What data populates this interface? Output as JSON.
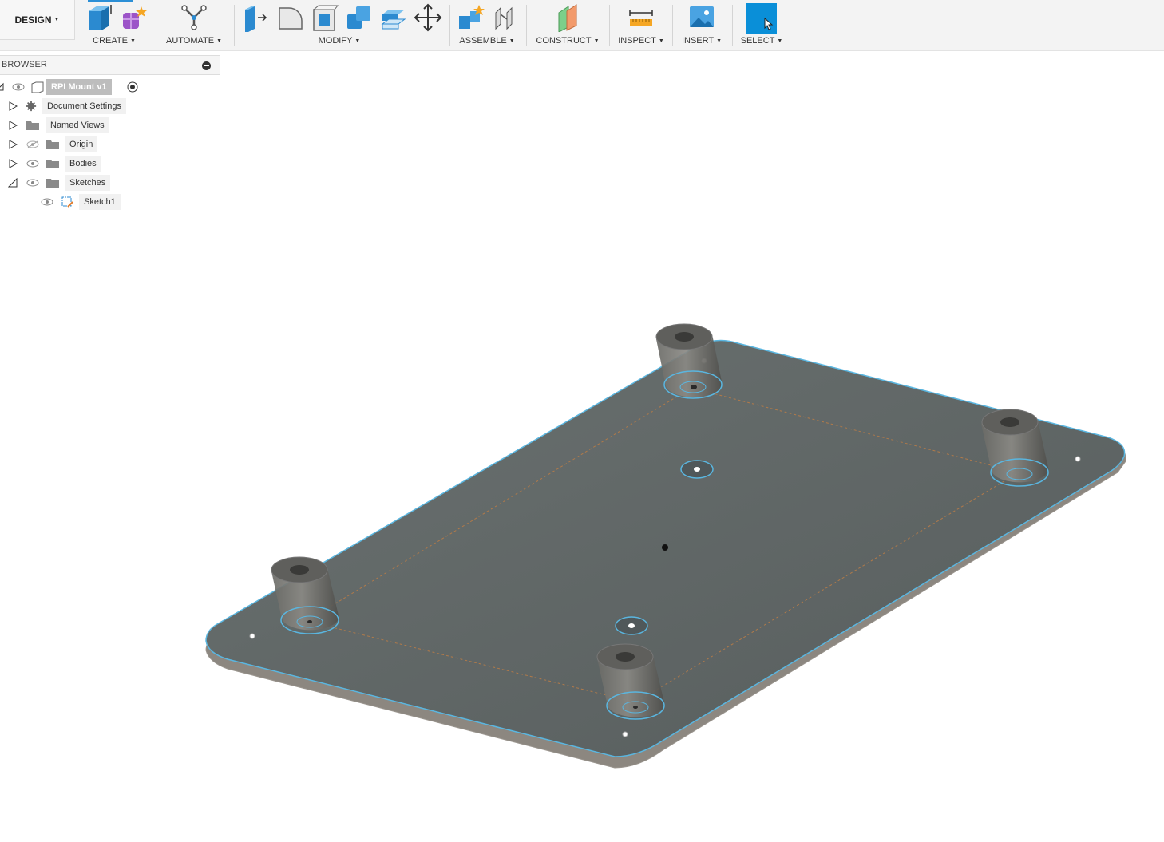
{
  "toolbar": {
    "workspace_label": "DESIGN",
    "groups": [
      {
        "label": "CREATE"
      },
      {
        "label": "AUTOMATE"
      },
      {
        "label": "MODIFY"
      },
      {
        "label": "ASSEMBLE"
      },
      {
        "label": "CONSTRUCT"
      },
      {
        "label": "INSPECT"
      },
      {
        "label": "INSERT"
      },
      {
        "label": "SELECT"
      }
    ],
    "accent": "#0a8fd8"
  },
  "browser": {
    "title": "BROWSER",
    "root": {
      "label": "RPI Mount v1"
    },
    "items": [
      {
        "label": "Document Settings"
      },
      {
        "label": "Named Views"
      },
      {
        "label": "Origin"
      },
      {
        "label": "Bodies"
      },
      {
        "label": "Sketches"
      },
      {
        "label": "Sketch1"
      }
    ]
  },
  "colors": {
    "plate": "#5f6565",
    "outline": "#5ab6e0",
    "sketch_line": "#b07a4a"
  }
}
